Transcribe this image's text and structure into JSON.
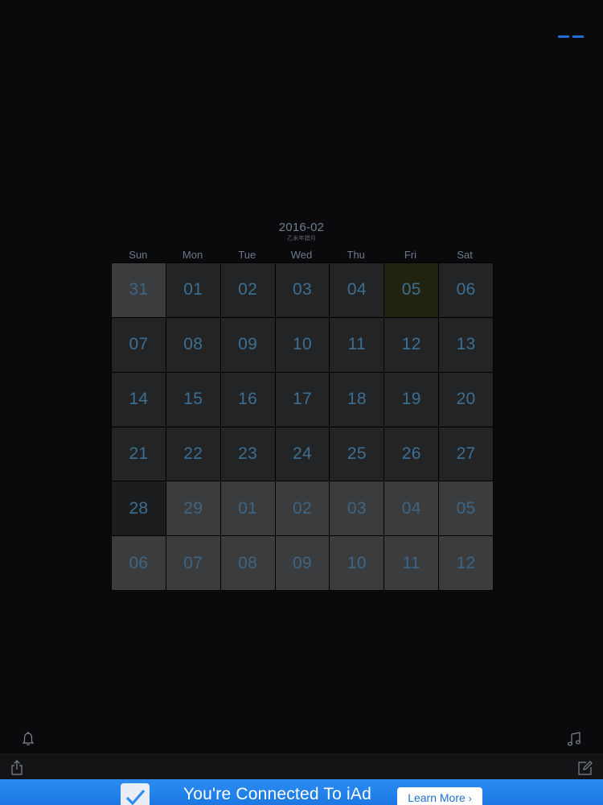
{
  "header": {
    "month": "2016-02",
    "lunar_month": "乙未年腊月"
  },
  "weekdays": [
    "Sun",
    "Mon",
    "Tue",
    "Wed",
    "Thu",
    "Fri",
    "Sat"
  ],
  "calendar": {
    "weeks": [
      [
        {
          "day": "31",
          "kind": "other"
        },
        {
          "day": "01",
          "kind": "current"
        },
        {
          "day": "02",
          "kind": "current"
        },
        {
          "day": "03",
          "kind": "current"
        },
        {
          "day": "04",
          "kind": "current"
        },
        {
          "day": "05",
          "kind": "today"
        },
        {
          "day": "06",
          "kind": "current"
        }
      ],
      [
        {
          "day": "07",
          "kind": "current"
        },
        {
          "day": "08",
          "kind": "current"
        },
        {
          "day": "09",
          "kind": "current"
        },
        {
          "day": "10",
          "kind": "current"
        },
        {
          "day": "11",
          "kind": "current"
        },
        {
          "day": "12",
          "kind": "current"
        },
        {
          "day": "13",
          "kind": "current"
        }
      ],
      [
        {
          "day": "14",
          "kind": "current"
        },
        {
          "day": "15",
          "kind": "current"
        },
        {
          "day": "16",
          "kind": "current"
        },
        {
          "day": "17",
          "kind": "current"
        },
        {
          "day": "18",
          "kind": "current"
        },
        {
          "day": "19",
          "kind": "current"
        },
        {
          "day": "20",
          "kind": "current"
        }
      ],
      [
        {
          "day": "21",
          "kind": "current"
        },
        {
          "day": "22",
          "kind": "current"
        },
        {
          "day": "23",
          "kind": "current"
        },
        {
          "day": "24",
          "kind": "current"
        },
        {
          "day": "25",
          "kind": "current"
        },
        {
          "day": "26",
          "kind": "current"
        },
        {
          "day": "27",
          "kind": "current"
        }
      ],
      [
        {
          "day": "28",
          "kind": "sunday-dark"
        },
        {
          "day": "29",
          "kind": "other"
        },
        {
          "day": "01",
          "kind": "other"
        },
        {
          "day": "02",
          "kind": "other"
        },
        {
          "day": "03",
          "kind": "other"
        },
        {
          "day": "04",
          "kind": "other"
        },
        {
          "day": "05",
          "kind": "other"
        }
      ],
      [
        {
          "day": "06",
          "kind": "other"
        },
        {
          "day": "07",
          "kind": "other"
        },
        {
          "day": "08",
          "kind": "other"
        },
        {
          "day": "09",
          "kind": "other"
        },
        {
          "day": "10",
          "kind": "other"
        },
        {
          "day": "11",
          "kind": "other"
        },
        {
          "day": "12",
          "kind": "other"
        }
      ]
    ]
  },
  "icons": {
    "menu": "menu-icon",
    "alarm": "bell-icon",
    "music": "music-note-icon",
    "share": "share-icon",
    "compose": "compose-icon",
    "check": "checkmark-icon"
  },
  "ad_banner": {
    "message": "You're Connected To iAd",
    "button_label": "Learn More",
    "button_chevron": "›"
  },
  "colors": {
    "accent": "#1f6fd6",
    "background": "#0a0a0d",
    "banner": "#2c8cf2"
  }
}
